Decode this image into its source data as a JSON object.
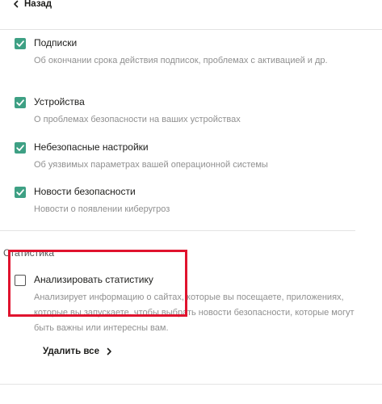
{
  "header": {
    "back_label": "Назад"
  },
  "options": [
    {
      "title": "Подписки",
      "description": "Об окончании срока действия подписок, проблемах с активацией и др.",
      "checked": true
    },
    {
      "title": "Устройства",
      "description": "О проблемах безопасности на ваших устройствах",
      "checked": true
    },
    {
      "title": "Небезопасные настройки",
      "description": "Об уязвимых параметрах вашей операционной системы",
      "checked": true
    },
    {
      "title": "Новости безопасности",
      "description": "Новости о появлении киберугроз",
      "checked": true
    }
  ],
  "statistics": {
    "section_title": "Статистика",
    "option": {
      "title": "Анализировать статистику",
      "description": "Анализирует информацию о сайтах, которые вы посещаете, приложениях, которые вы запускаете, чтобы выбрать новости безопасности, которые могут быть важны или интересны вам.",
      "checked": false
    },
    "delete_all_label": "Удалить все"
  },
  "colors": {
    "checkbox_checked": "#3ea084",
    "highlight": "#e0132e",
    "description_text": "#909090"
  }
}
